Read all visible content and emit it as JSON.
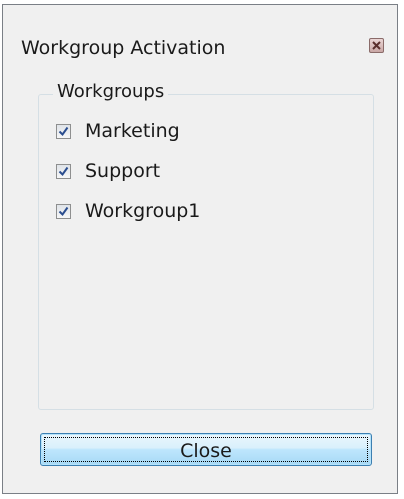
{
  "window": {
    "title": "Workgroup Activation",
    "close_icon": "close-icon"
  },
  "workgroups": {
    "legend": "Workgroups",
    "items": [
      {
        "label": "Marketing",
        "checked": true
      },
      {
        "label": "Support",
        "checked": true
      },
      {
        "label": "Workgroup1",
        "checked": true
      }
    ]
  },
  "footer": {
    "close_label": "Close"
  },
  "colors": {
    "window_bg": "#f0f0f0",
    "button_border": "#3c7fb1",
    "close_icon_bg": "#c9a7a5"
  }
}
